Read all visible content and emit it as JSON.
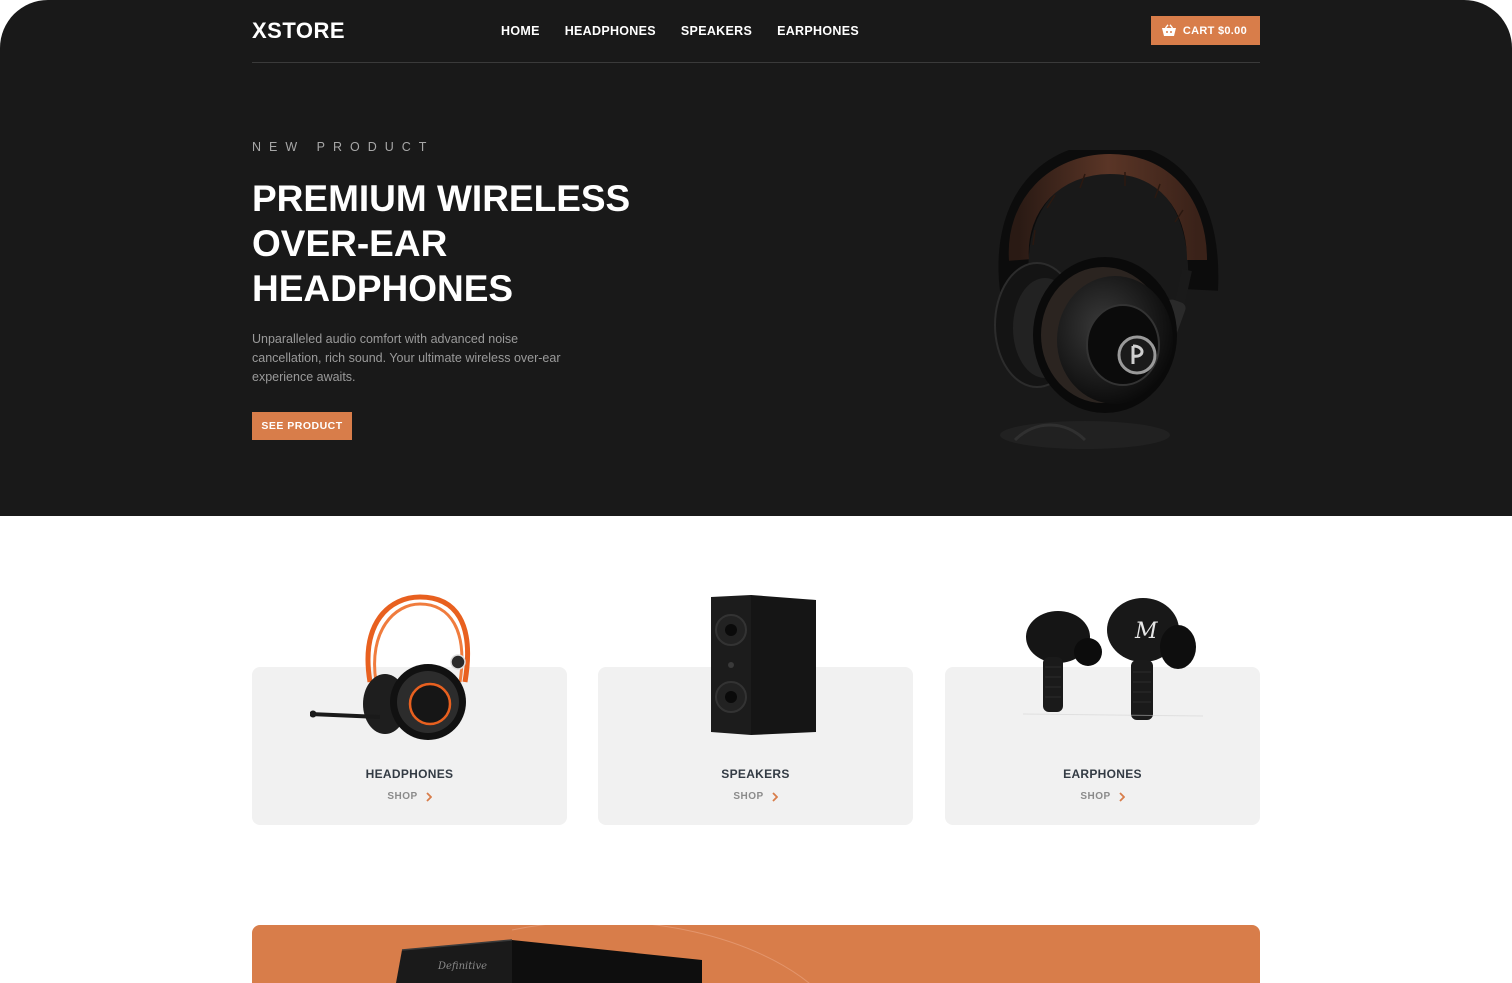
{
  "brand": {
    "logo": "XSTORE",
    "accent": "#d87d4a",
    "dark": "#191919"
  },
  "nav": {
    "items": [
      {
        "label": "HOME"
      },
      {
        "label": "HEADPHONES"
      },
      {
        "label": "SPEAKERS"
      },
      {
        "label": "EARPHONES"
      }
    ],
    "cart": {
      "icon": "basket-icon",
      "label": "CART $0.00"
    }
  },
  "hero": {
    "overline": "NEW PRODUCT",
    "title": "PREMIUM WIRELESS OVER-EAR HEADPHONES",
    "description": "Unparalleled audio comfort with advanced noise cancellation, rich sound. Your ultimate wireless over-ear experience awaits.",
    "cta": "SEE PRODUCT"
  },
  "categories": [
    {
      "name": "HEADPHONES",
      "link": "SHOP",
      "icon": "chevron-right-icon"
    },
    {
      "name": "SPEAKERS",
      "link": "SHOP",
      "icon": "chevron-right-icon"
    },
    {
      "name": "EARPHONES",
      "link": "SHOP",
      "icon": "chevron-right-icon"
    }
  ],
  "promo": {
    "brand_mark": "Definitive"
  }
}
